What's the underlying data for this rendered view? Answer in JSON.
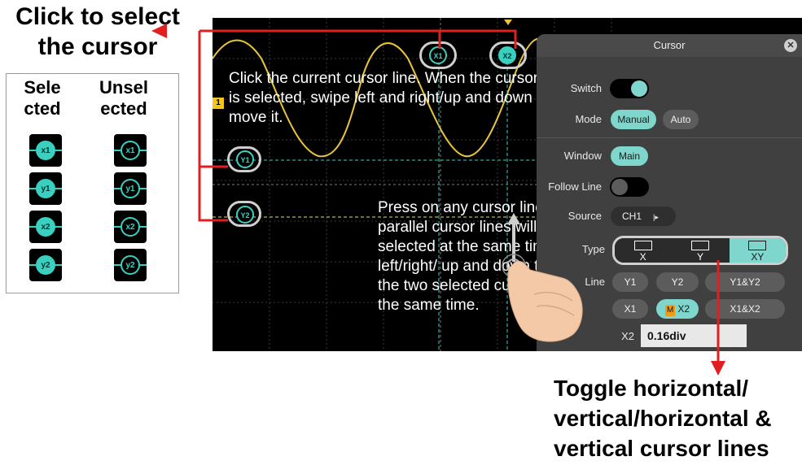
{
  "callouts": {
    "select_cursor": "Click to select the cursor",
    "toggle_lines": "Toggle horizontal/ vertical/horizontal & vertical cursor lines"
  },
  "legend": {
    "selected_header": "Sele cted",
    "unselected_header": "Unsel ected",
    "rows": [
      "x1",
      "y1",
      "x2",
      "y2"
    ]
  },
  "scope": {
    "channel_marker": "1",
    "cursor_tags": {
      "x1": "X1",
      "x2": "X2",
      "y1": "Y1",
      "y2": "Y2"
    },
    "instruction_click": "Click the current cursor line. When the cursor line is selected, swipe left and right/up and down to move it.",
    "instruction_press": "Press on any cursor line, two parallel cursor lines will be selected at the same time, left/right/ up and down to move the two selected cursor lines at the same time."
  },
  "panel": {
    "title": "Cursor",
    "close_icon": "✕",
    "switch_label": "Switch",
    "switch_on": true,
    "mode_label": "Mode",
    "mode_options": [
      "Manual",
      "Auto"
    ],
    "mode_selected": "Manual",
    "window_label": "Window",
    "window_value": "Main",
    "follow_line_label": "Follow Line",
    "follow_line_on": false,
    "source_label": "Source",
    "source_value": "CH1",
    "type_label": "Type",
    "type_options": [
      "X",
      "Y",
      "XY"
    ],
    "type_selected": "XY",
    "line_label": "Line",
    "line_row1": [
      "Y1",
      "Y2",
      "Y1&Y2"
    ],
    "line_row2_x1": "X1",
    "line_row2_x2": "X2",
    "line_row2_x1x2": "X1&X2",
    "line_m_badge": "M",
    "x2_label": "X2",
    "x2_value": "0.16div"
  },
  "colors": {
    "accent": "#7ed6cc",
    "cursor_line": "#3ad0c0",
    "waveform": "#e8c53a",
    "arrow": "#e02020"
  }
}
